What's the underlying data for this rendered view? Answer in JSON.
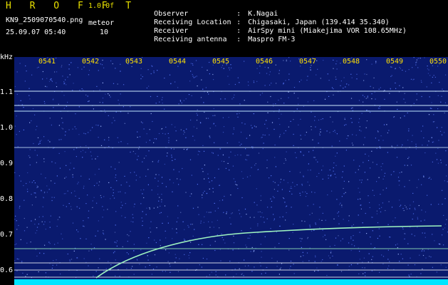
{
  "header": {
    "brand": "H R O F F T",
    "version": "1.0.0f",
    "filename": "KN9_2509070540.png",
    "timestamp": "25.09.07 05:40",
    "meteor_label": "meteor",
    "meteor_count": "10"
  },
  "meta": [
    {
      "key": "Observer",
      "value": "K.Nagai"
    },
    {
      "key": "Receiving Location",
      "value": "Chigasaki, Japan (139.414 35.340)"
    },
    {
      "key": "Receiver",
      "value": "AirSpy mini (Miakejima VOR 108.65MHz)"
    },
    {
      "key": "Receiving antenna",
      "value": "Maspro FM-3"
    }
  ],
  "axis": {
    "y_unit": "kHz",
    "y_ticks": [
      "1.1",
      "1.0",
      "0.9",
      "0.8",
      "0.7",
      "0.6"
    ],
    "x_ticks": [
      "0541",
      "0542",
      "0543",
      "0544",
      "0545",
      "0546",
      "0547",
      "0548",
      "0549",
      "0550"
    ]
  },
  "colors": {
    "background": "#0a1a6e",
    "noise": "#5a7bff",
    "trace": "#9ff5c0",
    "bottom_band": "#00e5ff",
    "tick_label": "#ffe000"
  }
}
